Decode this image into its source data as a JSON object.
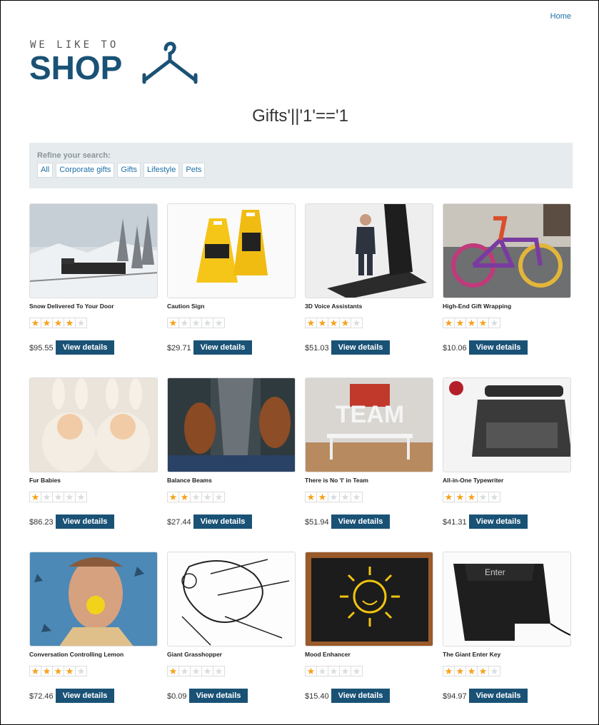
{
  "nav": {
    "home_label": "Home"
  },
  "logo": {
    "top_text": "WE LIKE TO",
    "main_text": "SHOP"
  },
  "page_title": "Gifts'||'1'=='1",
  "refine": {
    "label": "Refine your search:",
    "filters": [
      "All",
      "Corporate gifts",
      "Gifts",
      "Lifestyle",
      "Pets"
    ]
  },
  "button_label": "View details",
  "products": [
    {
      "name": "Snow Delivered To Your Door",
      "rating": 4,
      "price": "$95.55"
    },
    {
      "name": "Caution Sign",
      "rating": 1,
      "price": "$29.71"
    },
    {
      "name": "3D Voice Assistants",
      "rating": 4,
      "price": "$51.03"
    },
    {
      "name": "High-End Gift Wrapping",
      "rating": 4,
      "price": "$10.06"
    },
    {
      "name": "Fur Babies",
      "rating": 1,
      "price": "$86.23"
    },
    {
      "name": "Balance Beams",
      "rating": 2,
      "price": "$27.44"
    },
    {
      "name": "There is No 'I' in Team",
      "rating": 2,
      "price": "$51.94"
    },
    {
      "name": "All-in-One Typewriter",
      "rating": 3,
      "price": "$41.31"
    },
    {
      "name": "Conversation Controlling Lemon",
      "rating": 4,
      "price": "$72.46"
    },
    {
      "name": "Giant Grasshopper",
      "rating": 1,
      "price": "$0.09"
    },
    {
      "name": "Mood Enhancer",
      "rating": 1,
      "price": "$15.40"
    },
    {
      "name": "The Giant Enter Key",
      "rating": 4,
      "price": "$94.97"
    }
  ],
  "colors": {
    "brand": "#1a5276",
    "link": "#1e6fa6",
    "star_on": "#f6a21c",
    "star_off": "#d8dde0",
    "refine_bg": "#e6ebee"
  }
}
